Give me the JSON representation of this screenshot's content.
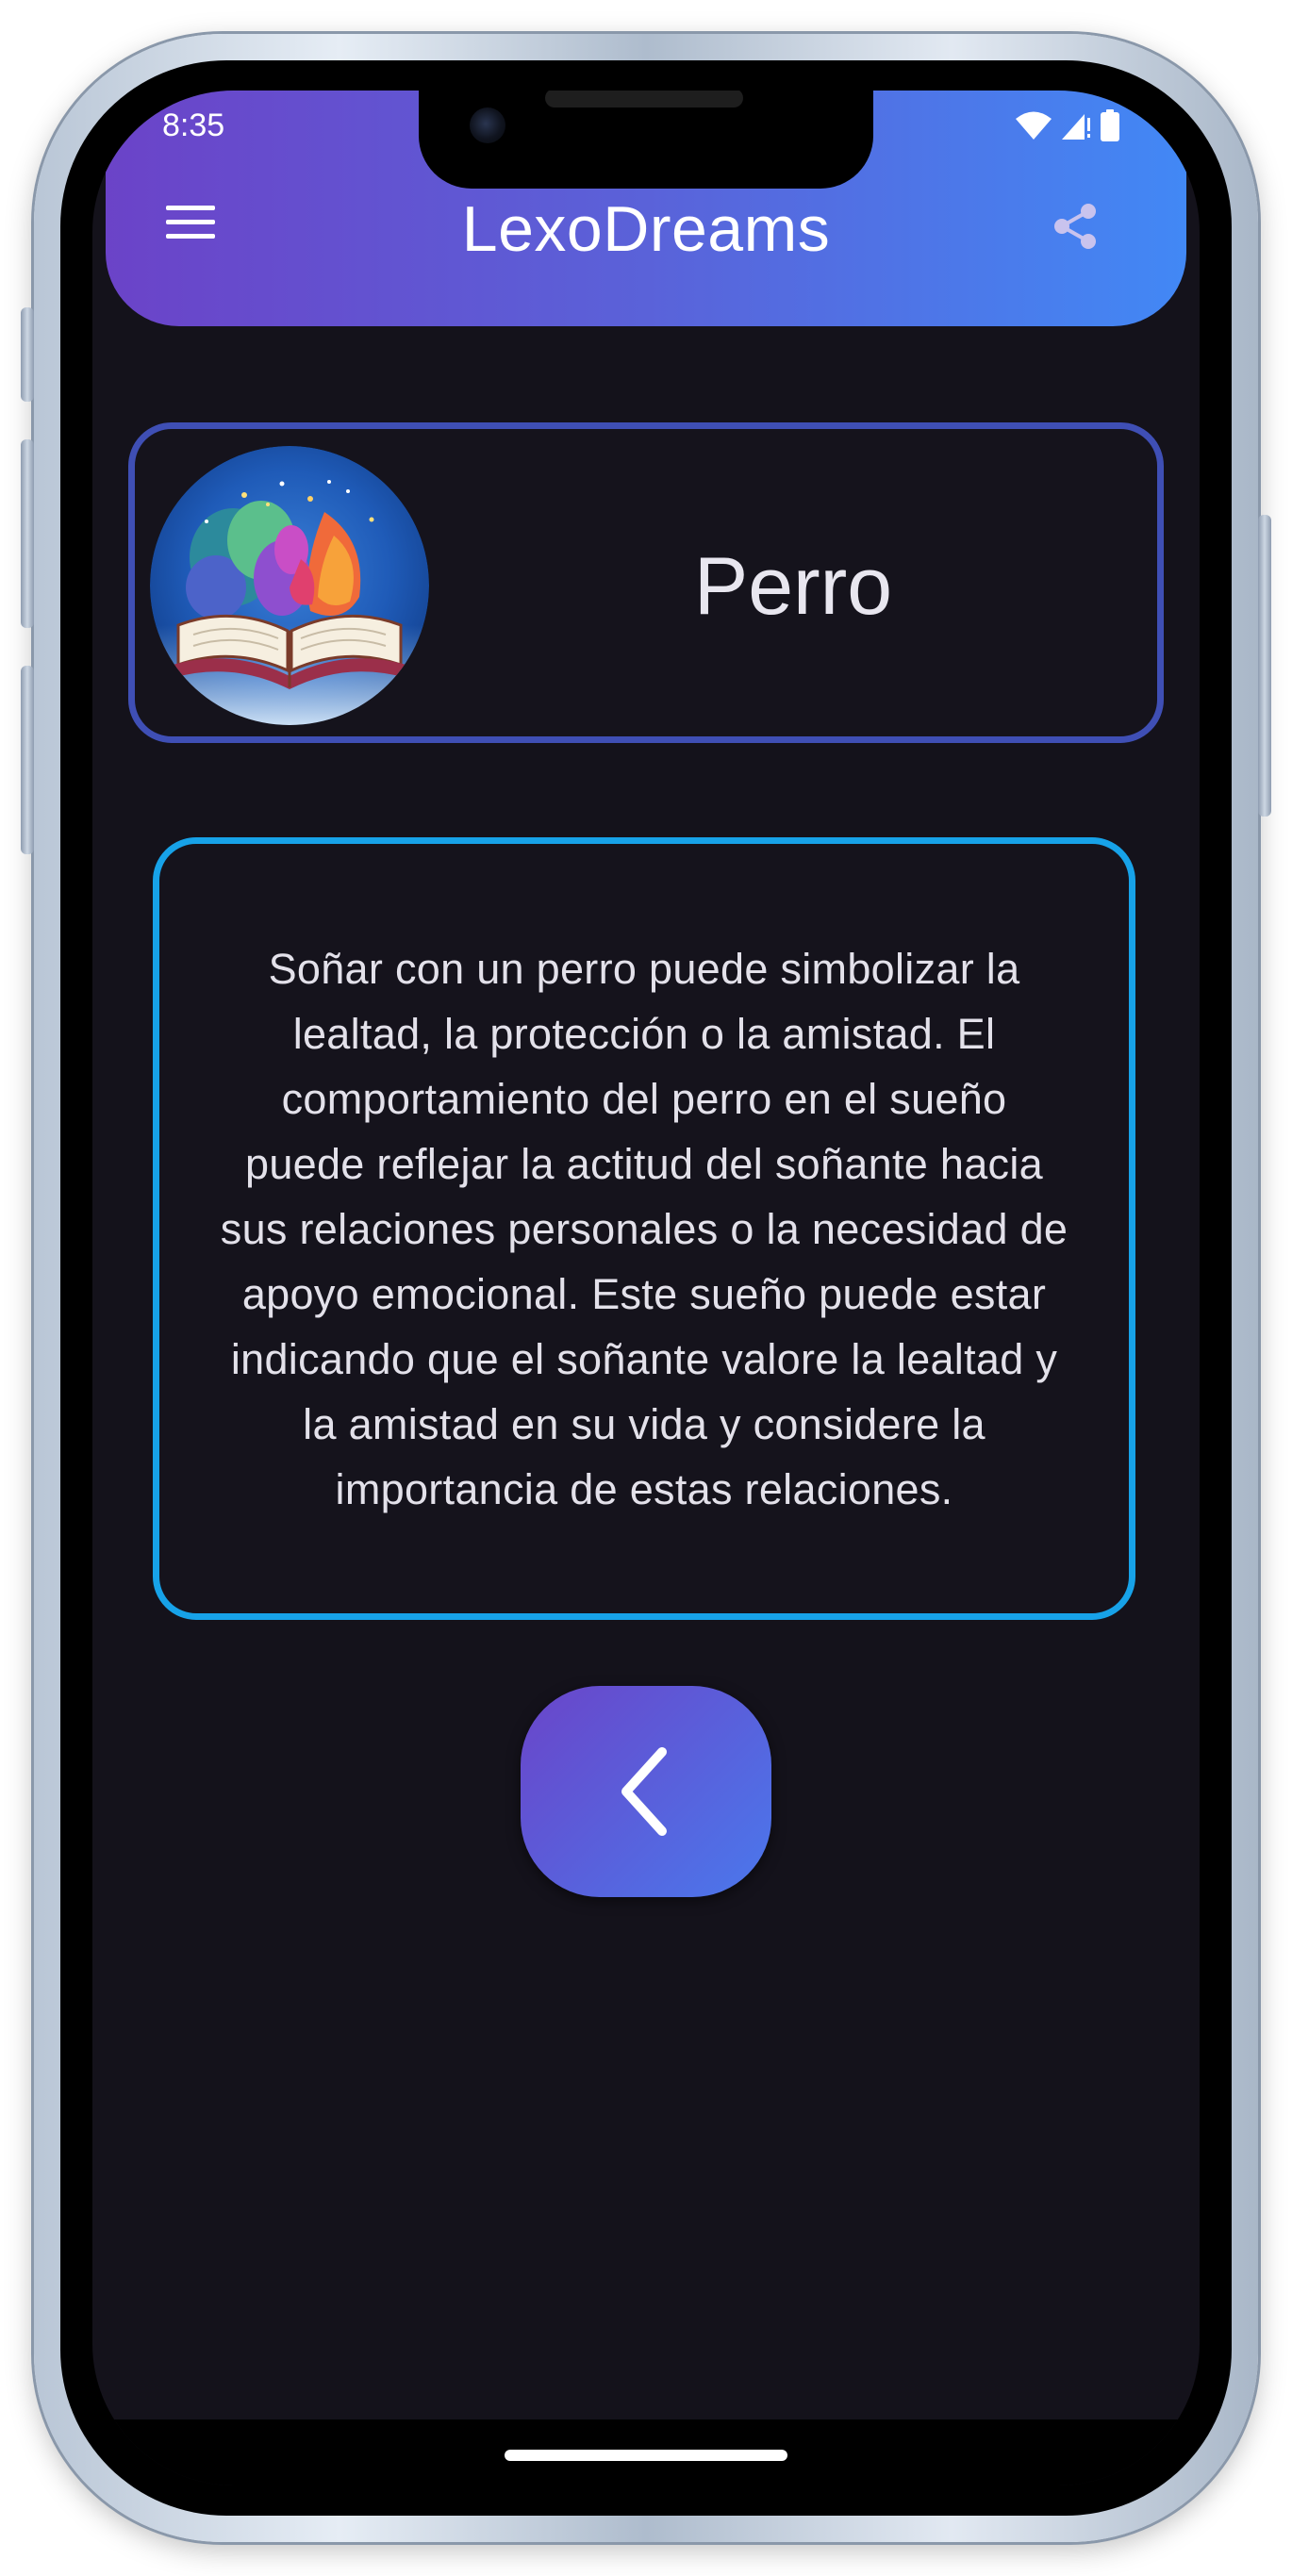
{
  "status_bar": {
    "time": "8:35"
  },
  "app_bar": {
    "title": "LexoDreams",
    "menu_icon": "hamburger-menu-icon",
    "share_icon": "share-icon",
    "gradient_start": "#6b43c8",
    "gradient_end": "#4288f5"
  },
  "dream": {
    "title": "Perro",
    "logo_icon": "open-book-dream-logo",
    "description": "Soñar con un perro puede simbolizar la lealtad, la protección o la amistad. El comportamiento del perro en el sueño puede reflejar la actitud del soñante hacia sus relaciones personales o la necesidad de apoyo emocional. Este sueño puede estar indicando que el soñante valore la lealtad y la amistad en su vida y considere la importancia de estas relaciones."
  },
  "back_button": {
    "icon": "chevron-left-icon"
  },
  "colors": {
    "background": "#14121b",
    "title_card_border": "#3f4fb5",
    "description_border": "#17a2e8"
  }
}
